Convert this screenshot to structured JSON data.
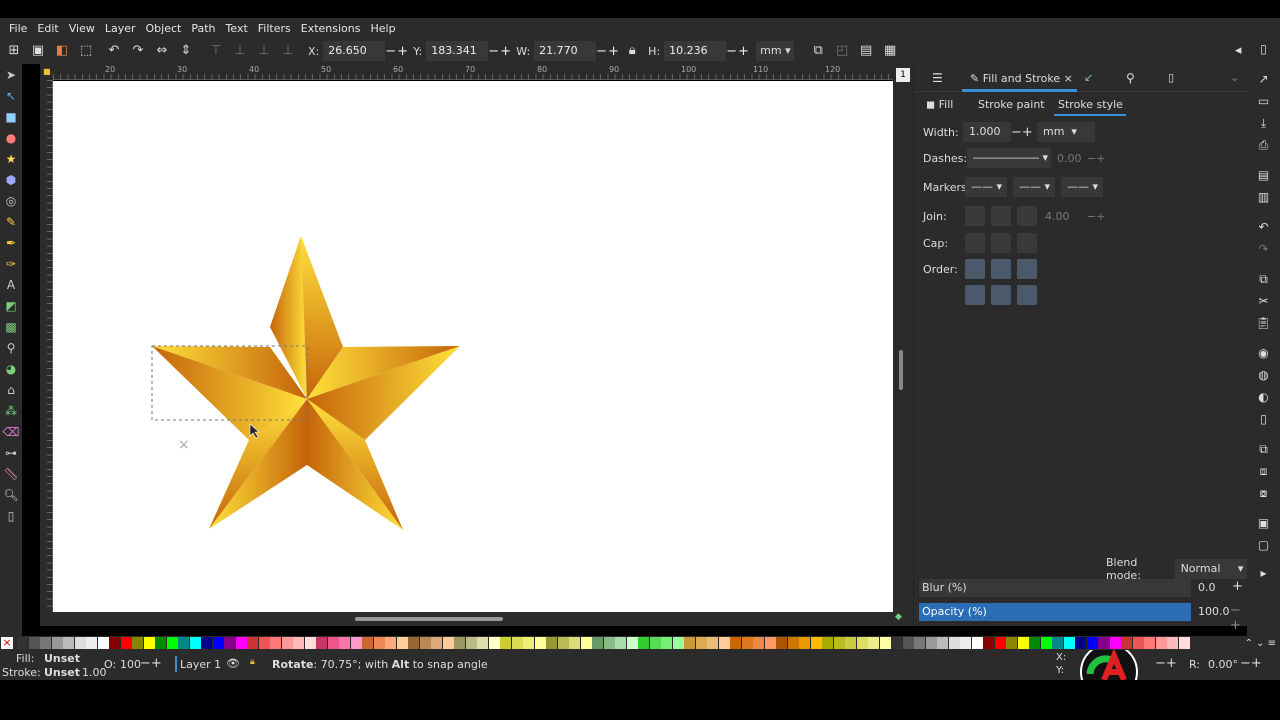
{
  "menu": [
    "File",
    "Edit",
    "View",
    "Layer",
    "Object",
    "Path",
    "Text",
    "Filters",
    "Extensions",
    "Help"
  ],
  "toolctl": {
    "x_label": "X:",
    "x_value": "26.650",
    "y_label": "Y:",
    "y_value": "183.341",
    "w_label": "W:",
    "w_value": "21.770",
    "h_label": "H:",
    "h_value": "10.236",
    "unit": "mm"
  },
  "ruler": {
    "h_ticks": [
      "20",
      "30",
      "40",
      "50",
      "60",
      "70",
      "80",
      "90",
      "100",
      "110",
      "120"
    ],
    "v_ticks": [
      "5",
      "1",
      "5",
      "1",
      "5",
      "1",
      "5",
      "1",
      "5",
      "1",
      "5",
      "1",
      "5",
      "1",
      "5",
      "1",
      "5"
    ]
  },
  "panel": {
    "title": "Fill and Stroke",
    "tabs": {
      "fill": "Fill",
      "stroke_paint": "Stroke paint",
      "stroke_style": "Stroke style"
    },
    "width_label": "Width:",
    "width_value": "1.000",
    "width_unit": "mm",
    "dashes_label": "Dashes:",
    "dashes_value": "0.00",
    "markers_label": "Markers:",
    "join_label": "Join:",
    "join_value": "4.00",
    "cap_label": "Cap:",
    "order_label": "Order:",
    "blend_label": "Blend mode:",
    "blend_value": "Normal",
    "blur_label": "Blur (%)",
    "blur_value": "0.0",
    "opacity_label": "Opacity (%)",
    "opacity_value": "100.0"
  },
  "status": {
    "fill_label": "Fill:",
    "fill_value": "Unset",
    "stroke_label": "Stroke:",
    "stroke_value": "Unset",
    "stroke_width": "1.00",
    "opacity_label": "O:",
    "opacity_value": "100",
    "layer": "Layer 1",
    "message_bold": "Rotate",
    "message_mid": ": 70.75°; with ",
    "message_bold2": "Alt",
    "message_rest": " to snap angle",
    "cursor_x_label": "X:",
    "cursor_y_label": "Y:",
    "rotation_label": "R:",
    "rotation_value": "0.00°"
  },
  "colors": {
    "canvas": "#ffffff",
    "accent": "#3a8fd8",
    "opacity_bar": "#2a6db5",
    "star_dark": "#c5640a",
    "star_light": "#ffe13a"
  }
}
